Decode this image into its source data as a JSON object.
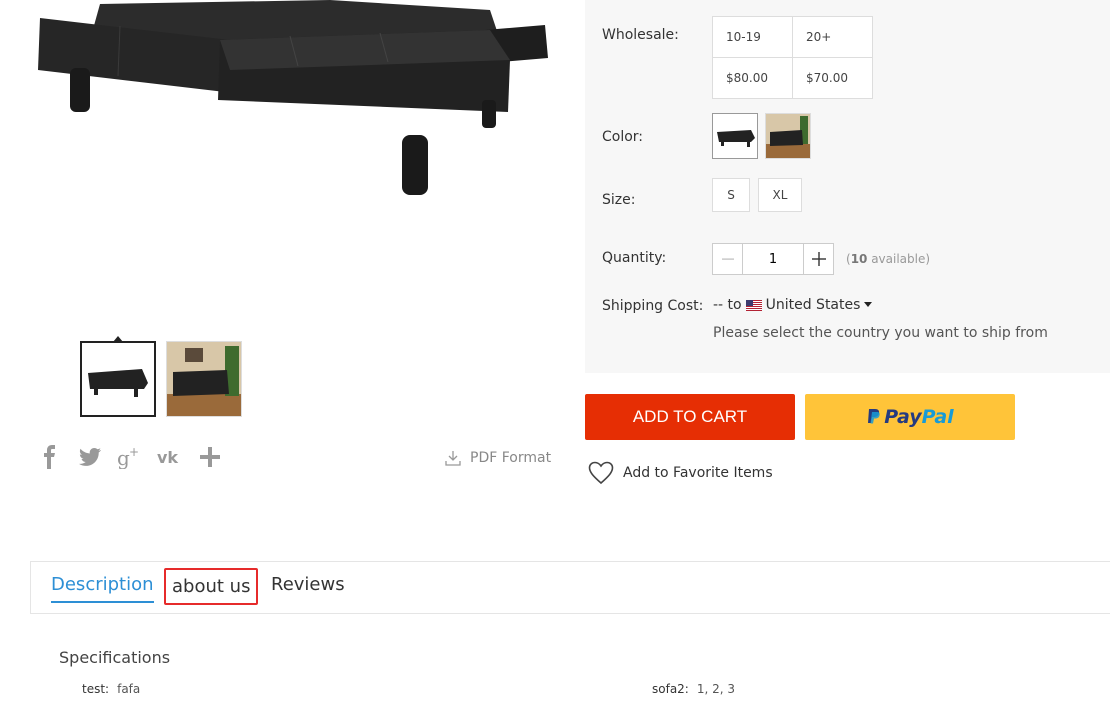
{
  "share": {
    "icons": [
      "facebook-icon",
      "twitter-icon",
      "google-plus-icon",
      "vk-icon",
      "plus-icon"
    ],
    "pdf_label": "PDF Format"
  },
  "product": {
    "wholesale_label": "Wholesale:",
    "wholesale": {
      "ranges": [
        "10-19",
        "20+"
      ],
      "prices": [
        "$80.00",
        "$70.00"
      ]
    },
    "color_label": "Color:",
    "size_label": "Size:",
    "sizes": [
      "S",
      "XL"
    ],
    "quantity_label": "Quantity:",
    "quantity_value": "1",
    "available_count": "10",
    "available_suffix": " available)",
    "available_prefix": "(",
    "shipping_label": "Shipping Cost:",
    "shipping_prefix": "-- to",
    "shipping_country": "United States",
    "shipping_note": "Please select the country you want to ship from"
  },
  "actions": {
    "add_to_cart": "ADD TO CART",
    "paypal_pay": "Pay",
    "paypal_pal": "Pal",
    "favorite": "Add to Favorite Items"
  },
  "tabs": [
    "Description",
    "about us",
    "Reviews"
  ],
  "specs": {
    "title": "Specifications",
    "items": [
      {
        "key": "test:",
        "value": "fafa"
      },
      {
        "key": "sofa2:",
        "value": "1, 2, 3"
      }
    ]
  },
  "colors": {
    "cart": "#e62e04",
    "paypal": "#ffc439",
    "tab_active": "#2d8fd5",
    "highlight_box": "#e62b2b"
  }
}
